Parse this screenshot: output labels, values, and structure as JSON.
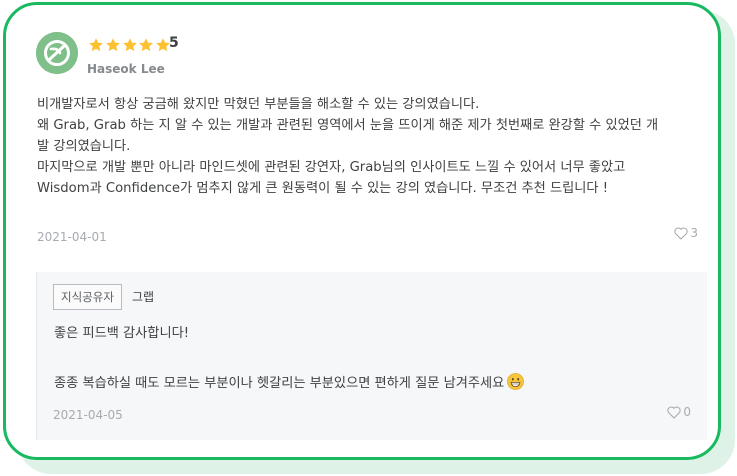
{
  "review": {
    "rating": "5",
    "stars_filled": 5,
    "author": "Haseok Lee",
    "body_lines": [
      "비개발자로서 항상 궁금해 왔지만 막혔던 부분들을 해소할 수 있는 강의였습니다.",
      "왜 Grab, Grab 하는 지 알 수 있는 개발과 관련된 영역에서 눈을 뜨이게 해준 제가 첫번째로 완강할 수 있었던 개",
      "발 강의였습니다.",
      "마지막으로 개발 뿐만 아니라 마인드셋에 관련된 강연자, Grab님의 인사이트도 느낄 수 있어서 너무 좋았고",
      "Wisdom과 Confidence가 멈추지 않게 큰 원동력이 될 수 있는 강의 였습니다. 무조건 추천 드립니다 !"
    ],
    "date": "2021-04-01",
    "likes": "3"
  },
  "reply": {
    "badge": "지식공유자",
    "author": "그랩",
    "lines": [
      "좋은 피드백 감사합니다!",
      "",
      "종종 복습하실 때도 모르는 부분이나 헷갈리는 부분있으면 편하게 질문 남겨주세요"
    ],
    "date": "2021-04-05",
    "likes": "0"
  },
  "colors": {
    "accent": "#19b960",
    "star": "#fdc02f",
    "muted": "#a7abb0",
    "reply_bg": "#f6f7f8"
  },
  "icons": {
    "avatar": "leaf-avatar-icon",
    "star": "star-icon",
    "like": "heart-outline-icon",
    "emoji": "grinning-face-emoji"
  }
}
